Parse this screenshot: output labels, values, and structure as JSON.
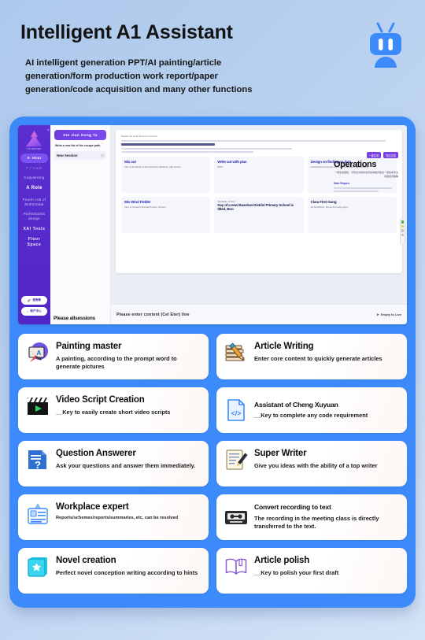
{
  "header": {
    "title": "Intelligent A1 Assistant",
    "subtitle": "AI intelligent generation PPT/AI painting/article generation/form production work report/paper generation/code acquisition and many other functions",
    "brand_icon": "robot-tv-icon",
    "brand_color": "#3d8bfb"
  },
  "panel": {
    "background_color": "#3d8bfb"
  },
  "app_screenshot": {
    "sidebar": {
      "logo_icon": "mountain-logo-icon",
      "brand": "Chaoxian",
      "collapse_icon": "collapse-icon",
      "items": [
        {
          "label": "A- Hour",
          "state": "active"
        },
        {
          "label": "P T made",
          "state": "dim"
        },
        {
          "label": "Copywriting",
          "state": "normal"
        },
        {
          "label": "A Role",
          "state": "big"
        },
        {
          "label": "Fourm cob of Multimodal",
          "state": "normal"
        },
        {
          "label": "Paintstudios design",
          "state": "normal"
        },
        {
          "label": "XAI Tools",
          "state": "mid"
        },
        {
          "label": "Floor Space",
          "state": "mid"
        }
      ],
      "buttons": [
        {
          "label": "使用教",
          "icon": "rocket-icon"
        },
        {
          "label": "账户中心",
          "icon": "clock-icon"
        }
      ]
    },
    "sessions": {
      "new_button": "Xin Jian Gong Ta",
      "hint": "Write a new list of the escape path.",
      "item": "New Session",
      "item_icon": "copy-icon",
      "footer_button": "Please allsessions"
    },
    "document": {
      "header_note": "Please the work list item in its form",
      "cards": [
        {
          "title": "Mix out",
          "sub": "Intro to Enhance a Stop Read to Students, talk entries"
        },
        {
          "title": "Write out with plan",
          "sub": "2019"
        },
        {
          "title": "Design on finding on data",
          "sub": "Instalment Forms are still in the process of determining"
        },
        {
          "title": "Mix Wind Fielder",
          "sub": "Intro to Content Special Primary School"
        },
        {
          "title": "Day of a new Baoshan District Primary School is titled, Boo",
          "sub": "Workable of Sop"
        },
        {
          "title": "Clara First Gung",
          "sub": "As lorephone, Demo first song entry"
        }
      ],
      "operations": {
        "badges": [
          "一键生成",
          "导出文档"
        ],
        "title": "Operations",
        "subtitle": "一键生成报告，可导出文档并支持多种格式输出一键生成专业内容运营策略",
        "tag": "Sale Report"
      },
      "float_toolbar_icons": [
        "grid-icon",
        "pin-icon",
        "undo-icon",
        "redo-icon"
      ]
    },
    "input_bar": {
      "placeholder": "Please enter content (Cel Eter) line",
      "send_label": "Empty to Live",
      "send_icon": "send-icon"
    }
  },
  "features": [
    {
      "title": "Painting master",
      "desc": "A painting, according to the prompt word to generate pictures",
      "icon": "ai-painting-icon",
      "title_size": "lg"
    },
    {
      "title": "Article Writing",
      "desc": "Enter core content to quickly generate articles",
      "icon": "books-pencil-icon",
      "title_size": "lg"
    },
    {
      "title": "Video Script Creation",
      "desc": "__Key to easily create short video scripts",
      "icon": "clapperboard-icon",
      "title_size": "lg"
    },
    {
      "title": "Assistant of Cheng Xuyuan",
      "desc": "__Key to complete any code requirement",
      "icon": "code-file-icon",
      "title_size": "sm"
    },
    {
      "title": "Question Answerer",
      "desc": "Ask your questions and answer them immediately.",
      "icon": "question-document-icon",
      "title_size": "lg"
    },
    {
      "title": "Super Writer",
      "desc": "Give you ideas with the ability of a top writer",
      "icon": "notepad-pen-icon",
      "title_size": "lg"
    },
    {
      "title": "Workplace expert",
      "desc": "Reports/schemes/reports/summaries, etc. can be resolved",
      "icon": "id-badge-icon",
      "title_size": "lg",
      "desc_size": "tiny"
    },
    {
      "title": "Convert recording to text",
      "desc": "The recording in the meeting class is directly transferred to the text.",
      "icon": "cassette-tape-icon",
      "title_size": "sm"
    },
    {
      "title": "Novel creation",
      "desc": "Perfect novel conception writing according to hints",
      "icon": "star-book-icon",
      "title_size": "lg"
    },
    {
      "title": "Article polish",
      "desc": "__Key to polish your first draft",
      "icon": "open-book-icon",
      "title_size": "lg"
    }
  ]
}
